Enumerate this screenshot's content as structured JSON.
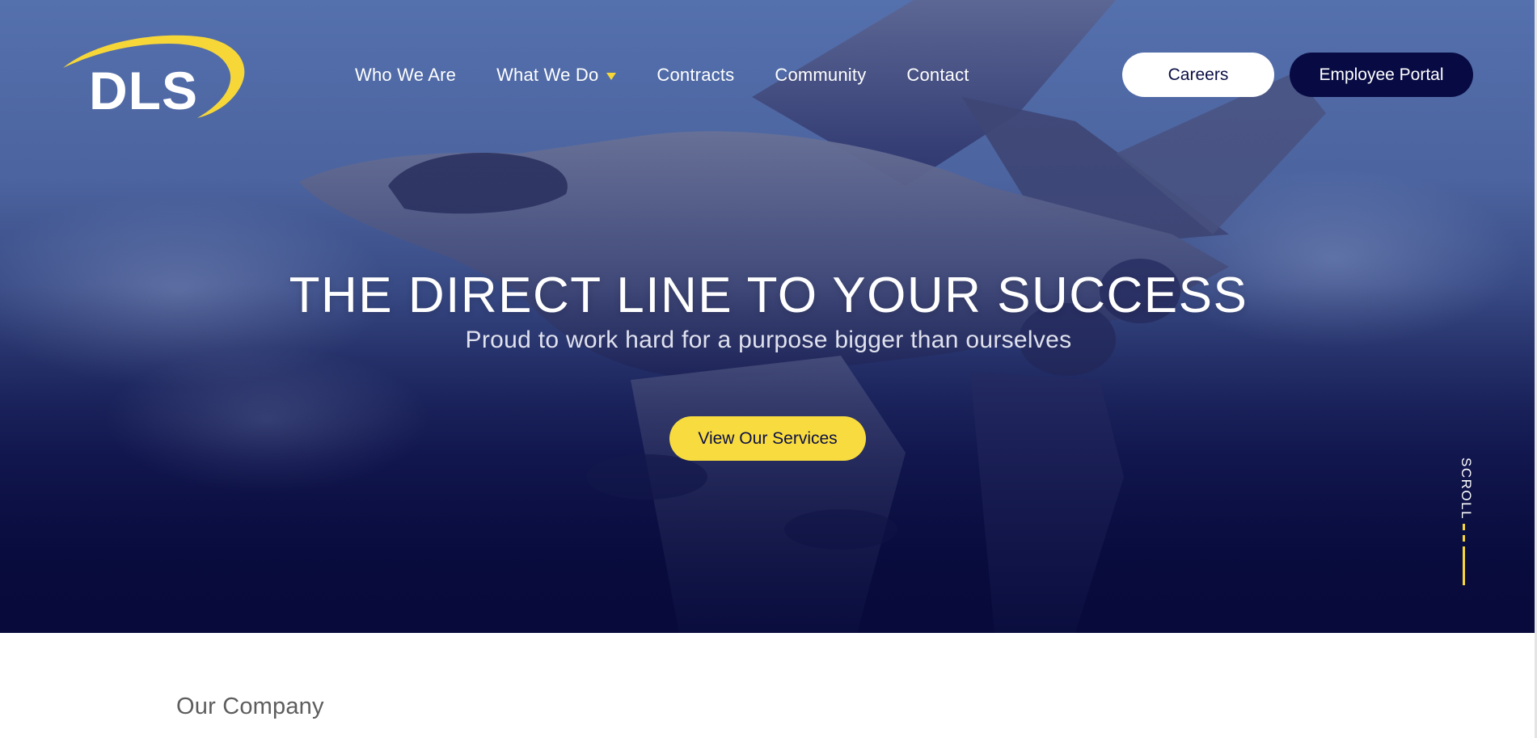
{
  "brand": {
    "logo_text": "DLS",
    "logo_icon": "dls-swoosh-logo",
    "accent_color": "#f7d738",
    "navy_color": "#080b43"
  },
  "nav": {
    "items": [
      {
        "label": "Who We Are"
      },
      {
        "label": "What We Do",
        "has_dropdown": true
      },
      {
        "label": "Contracts"
      },
      {
        "label": "Community"
      },
      {
        "label": "Contact"
      }
    ]
  },
  "header_actions": {
    "careers_label": "Careers",
    "portal_label": "Employee Portal"
  },
  "hero": {
    "background": "fighter-jet-in-flight-photo",
    "headline": "THE DIRECT LINE TO YOUR SUCCESS",
    "subheadline": "Proud to work hard for a purpose bigger than ourselves",
    "cta_label": "View Our Services",
    "scroll_label": "SCROLL"
  },
  "sections": {
    "company_title": "Our Company"
  }
}
